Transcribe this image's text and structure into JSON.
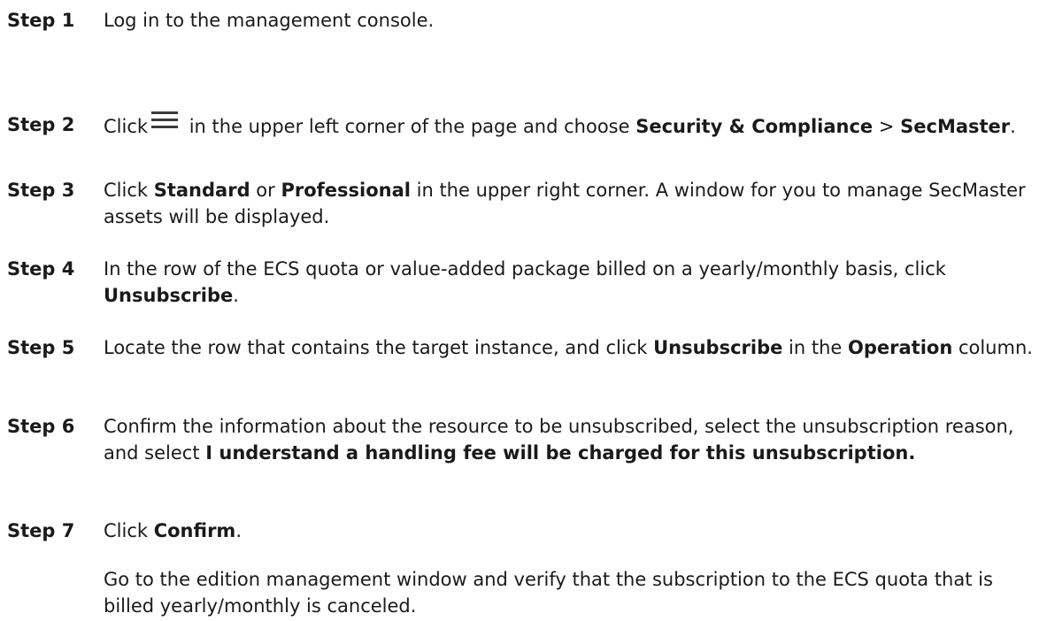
{
  "steps": [
    {
      "label": "Step 1",
      "t1": "Log in to the management console."
    },
    {
      "label": "Step 2",
      "t1": "Click",
      "icon": "menu-icon",
      "t2": " in the upper left corner of the page and choose ",
      "b1": "Security & Compliance",
      "t3": " > ",
      "b2": "SecMaster",
      "t4": "."
    },
    {
      "label": "Step 3",
      "t1": "Click ",
      "b1": "Standard",
      "t2": " or ",
      "b2": "Professional",
      "t3": " in the upper right corner. A window for you to manage SecMaster assets will be displayed."
    },
    {
      "label": "Step 4",
      "t1": "In the row of the ECS quota or value-added package billed on a yearly/monthly basis, click ",
      "b1": "Unsubscribe",
      "t2": "."
    },
    {
      "label": "Step 5",
      "t1": "Locate the row that contains the target instance, and click ",
      "b1": "Unsubscribe",
      "t2": " in the ",
      "b2": "Operation",
      "t3": " column."
    },
    {
      "label": "Step 6",
      "t1": "Confirm the information about the resource to be unsubscribed, select the unsubscription reason, and select ",
      "b1": "I understand a handling fee will be charged for this unsubscription."
    },
    {
      "label": "Step 7",
      "t1": "Click ",
      "b1": "Confirm",
      "t2": "."
    }
  ],
  "note": "Go to the edition management window and verify that the subscription to the ECS quota that is billed yearly/monthly is canceled."
}
